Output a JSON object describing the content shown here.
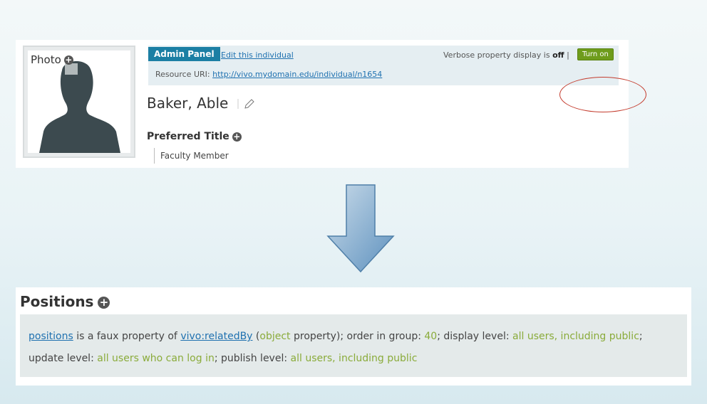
{
  "profile": {
    "photo_label": "Photo",
    "admin": {
      "panel_label": "Admin Panel",
      "edit_link": "Edit this individual",
      "verbose_prefix": "Verbose property display is",
      "verbose_state": "off",
      "verbose_separator": "|",
      "turn_on_label": "Turn on",
      "uri_label": "Resource URI:",
      "uri_value": "http://vivo.mydomain.edu/individual/n1654"
    },
    "name": "Baker, Able",
    "preferred_title_label": "Preferred Title",
    "preferred_title_value": "Faculty Member"
  },
  "positions": {
    "heading": "Positions",
    "property_link": "positions",
    "t1": " is a faux property of ",
    "base_link": "vivo:relatedBy",
    "t2": " (",
    "object_word": "object",
    "t3": " property); order in group: ",
    "order": "40",
    "t4": "; display level: ",
    "display_level": "all users, including public",
    "t5": "; update level: ",
    "update_level": "all users who can log in",
    "t6": "; publish level: ",
    "publish_level": "all users, including public"
  },
  "colors": {
    "admin_panel": "#1c7fa4",
    "turn_on": "#6e9c1c",
    "highlight_circle": "#c43c2e",
    "arrow": "#6f9fc6",
    "green_values": "#8aab3a"
  }
}
